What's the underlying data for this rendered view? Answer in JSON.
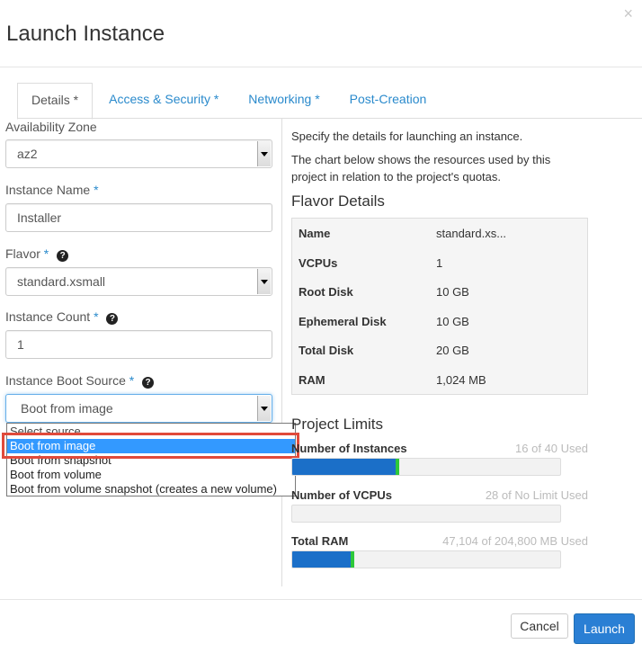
{
  "dialog": {
    "title": "Launch Instance",
    "close_glyph": "×"
  },
  "tabs": [
    {
      "label": "Details *",
      "active": true
    },
    {
      "label": "Access & Security *",
      "active": false
    },
    {
      "label": "Networking *",
      "active": false
    },
    {
      "label": "Post-Creation",
      "active": false
    }
  ],
  "form": {
    "availability_zone": {
      "label": "Availability Zone",
      "value": "az2"
    },
    "instance_name": {
      "label": "Instance Name",
      "required": "*",
      "value": "Installer"
    },
    "flavor": {
      "label": "Flavor",
      "required": "*",
      "value": "standard.xsmall",
      "help_icon": "?"
    },
    "instance_count": {
      "label": "Instance Count",
      "required": "*",
      "value": "1",
      "help_icon": "?"
    },
    "boot_source": {
      "label": "Instance Boot Source",
      "required": "*",
      "value": "Boot from image",
      "help_icon": "?",
      "options": [
        "Select source",
        "Boot from image",
        "Boot from snapshot",
        "Boot from volume",
        "Boot from volume snapshot (creates a new volume)"
      ],
      "selected_index": 1
    }
  },
  "info": {
    "desc1": "Specify the details for launching an instance.",
    "desc2": "The chart below shows the resources used by this project in relation to the project's quotas."
  },
  "flavor_details": {
    "title": "Flavor Details",
    "rows": [
      {
        "key": "Name",
        "value": "standard.xs..."
      },
      {
        "key": "VCPUs",
        "value": "1"
      },
      {
        "key": "Root Disk",
        "value": "10 GB"
      },
      {
        "key": "Ephemeral Disk",
        "value": "10 GB"
      },
      {
        "key": "Total Disk",
        "value": "20 GB"
      },
      {
        "key": "RAM",
        "value": "1,024 MB"
      }
    ]
  },
  "project_limits": {
    "title": "Project Limits",
    "items": [
      {
        "label": "Number of Instances",
        "used_text": "16 of 40 Used",
        "fraction": 0.4
      },
      {
        "label": "Number of VCPUs",
        "used_text": "28 of No Limit Used",
        "fraction": 0
      },
      {
        "label": "Total RAM",
        "used_text": "47,104 of 204,800 MB Used",
        "fraction": 0.23
      }
    ]
  },
  "colors": {
    "link": "#2a8acc",
    "accent": "#2a7fd4",
    "bar_fill": "#1b6fc8",
    "bar_tip": "#2ec83a",
    "highlight_box": "#e04a3b",
    "dropdown_selected": "#3399ff"
  },
  "footer": {
    "cancel_label": "Cancel",
    "launch_label": "Launch"
  }
}
